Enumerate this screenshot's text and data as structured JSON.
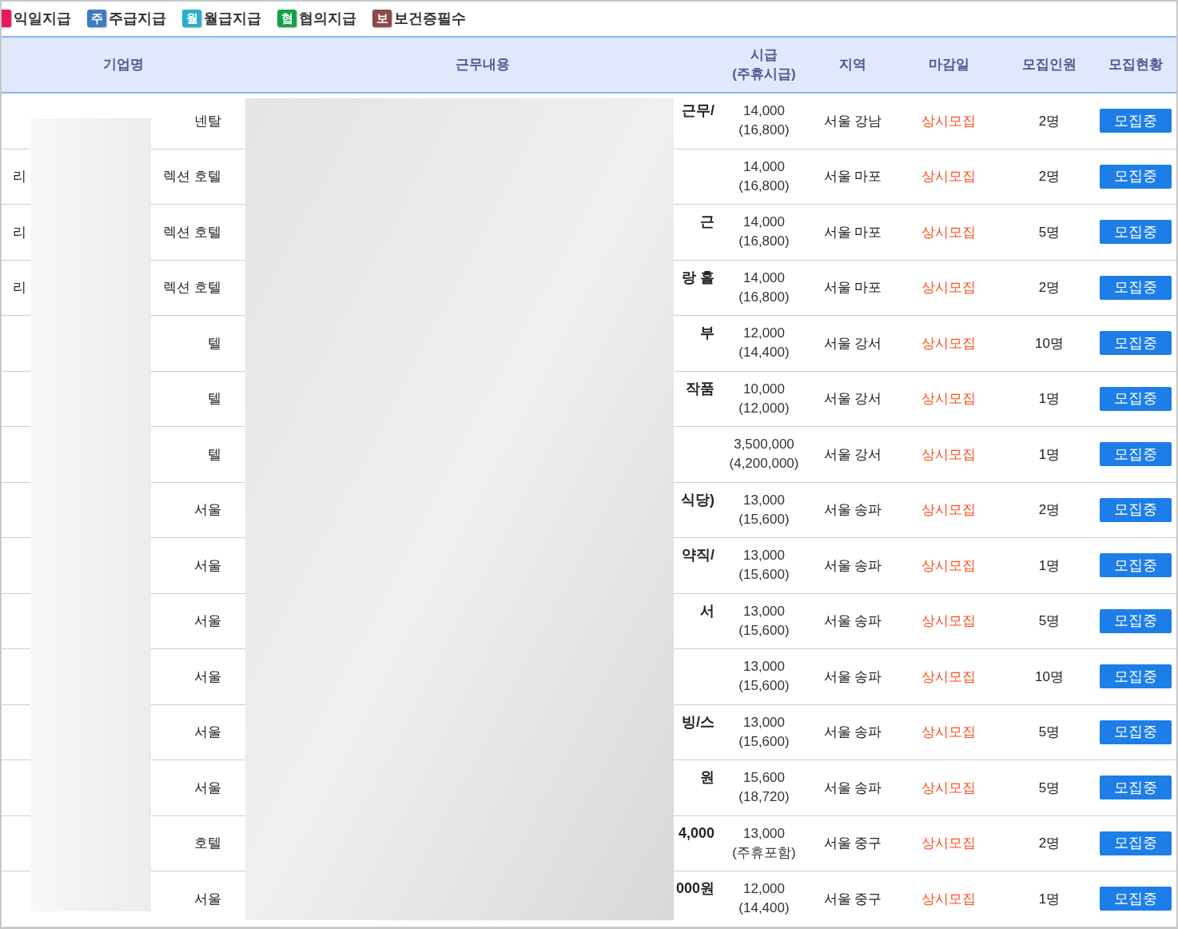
{
  "legend": [
    {
      "label": "익일지급",
      "color": "#e8185a"
    },
    {
      "badge": "주",
      "label": "주급지급",
      "color": "#3d7cc4"
    },
    {
      "badge": "월",
      "label": "월급지급",
      "color": "#2aaed0"
    },
    {
      "badge": "협",
      "label": "협의지급",
      "color": "#12a34a"
    },
    {
      "badge": "보",
      "label": "보건증필수",
      "color": "#8b4a4a"
    }
  ],
  "table": {
    "columns": [
      "기업명",
      "근무내용",
      "시급\n(주휴시급)",
      "지역",
      "마감일",
      "모집인원",
      "모집현황"
    ],
    "rows": [
      {
        "company_right": "넨탈",
        "work": "근무/",
        "wage": "14,000",
        "wage_weekly": "(16,800)",
        "region": "서울 강남",
        "deadline": "상시모집",
        "count": "2명",
        "status": "모집중"
      },
      {
        "company_left": "리",
        "company_right": "렉션 호텔",
        "wage": "14,000",
        "wage_weekly": "(16,800)",
        "region": "서울 마포",
        "deadline": "상시모집",
        "count": "2명",
        "status": "모집중"
      },
      {
        "company_left": "리",
        "company_right": "렉션 호텔",
        "work": "근",
        "wage": "14,000",
        "wage_weekly": "(16,800)",
        "region": "서울 마포",
        "deadline": "상시모집",
        "count": "5명",
        "status": "모집중"
      },
      {
        "company_left": "리",
        "company_right": "렉션 호텔",
        "work": "랑 홀",
        "wage": "14,000",
        "wage_weekly": "(16,800)",
        "region": "서울 마포",
        "deadline": "상시모집",
        "count": "2명",
        "status": "모집중"
      },
      {
        "company_right": "텔",
        "work": "부",
        "wage": "12,000",
        "wage_weekly": "(14,400)",
        "region": "서울 강서",
        "deadline": "상시모집",
        "count": "10명",
        "status": "모집중"
      },
      {
        "company_right": "텔",
        "work": "작품",
        "wage": "10,000",
        "wage_weekly": "(12,000)",
        "region": "서울 강서",
        "deadline": "상시모집",
        "count": "1명",
        "status": "모집중"
      },
      {
        "company_right": "텔",
        "wage": "3,500,000",
        "wage_weekly": "(4,200,000)",
        "region": "서울 강서",
        "deadline": "상시모집",
        "count": "1명",
        "status": "모집중"
      },
      {
        "company_right": "서울",
        "work": "식당)",
        "wage": "13,000",
        "wage_weekly": "(15,600)",
        "region": "서울 송파",
        "deadline": "상시모집",
        "count": "2명",
        "status": "모집중"
      },
      {
        "company_right": "서울",
        "work": "약직/",
        "wage": "13,000",
        "wage_weekly": "(15,600)",
        "region": "서울 송파",
        "deadline": "상시모집",
        "count": "1명",
        "status": "모집중"
      },
      {
        "company_right": "서울",
        "work": "서",
        "wage": "13,000",
        "wage_weekly": "(15,600)",
        "region": "서울 송파",
        "deadline": "상시모집",
        "count": "5명",
        "status": "모집중"
      },
      {
        "company_right": "서울",
        "wage": "13,000",
        "wage_weekly": "(15,600)",
        "region": "서울 송파",
        "deadline": "상시모집",
        "count": "10명",
        "status": "모집중"
      },
      {
        "company_right": "서울",
        "work": "빙/스",
        "wage": "13,000",
        "wage_weekly": "(15,600)",
        "region": "서울 송파",
        "deadline": "상시모집",
        "count": "5명",
        "status": "모집중"
      },
      {
        "company_right": "서울",
        "work": "원",
        "wage": "15,600",
        "wage_weekly": "(18,720)",
        "region": "서울 송파",
        "deadline": "상시모집",
        "count": "5명",
        "status": "모집중"
      },
      {
        "company_right": "호텔",
        "work": "4,000",
        "wage": "13,000",
        "wage_weekly": "(주휴포함)",
        "region": "서울 중구",
        "deadline": "상시모집",
        "count": "2명",
        "status": "모집중"
      },
      {
        "company_right": "서울",
        "work": "000원",
        "wage": "12,000",
        "wage_weekly": "(14,400)",
        "region": "서울 중구",
        "deadline": "상시모집",
        "count": "1명",
        "status": "모집중"
      }
    ]
  }
}
